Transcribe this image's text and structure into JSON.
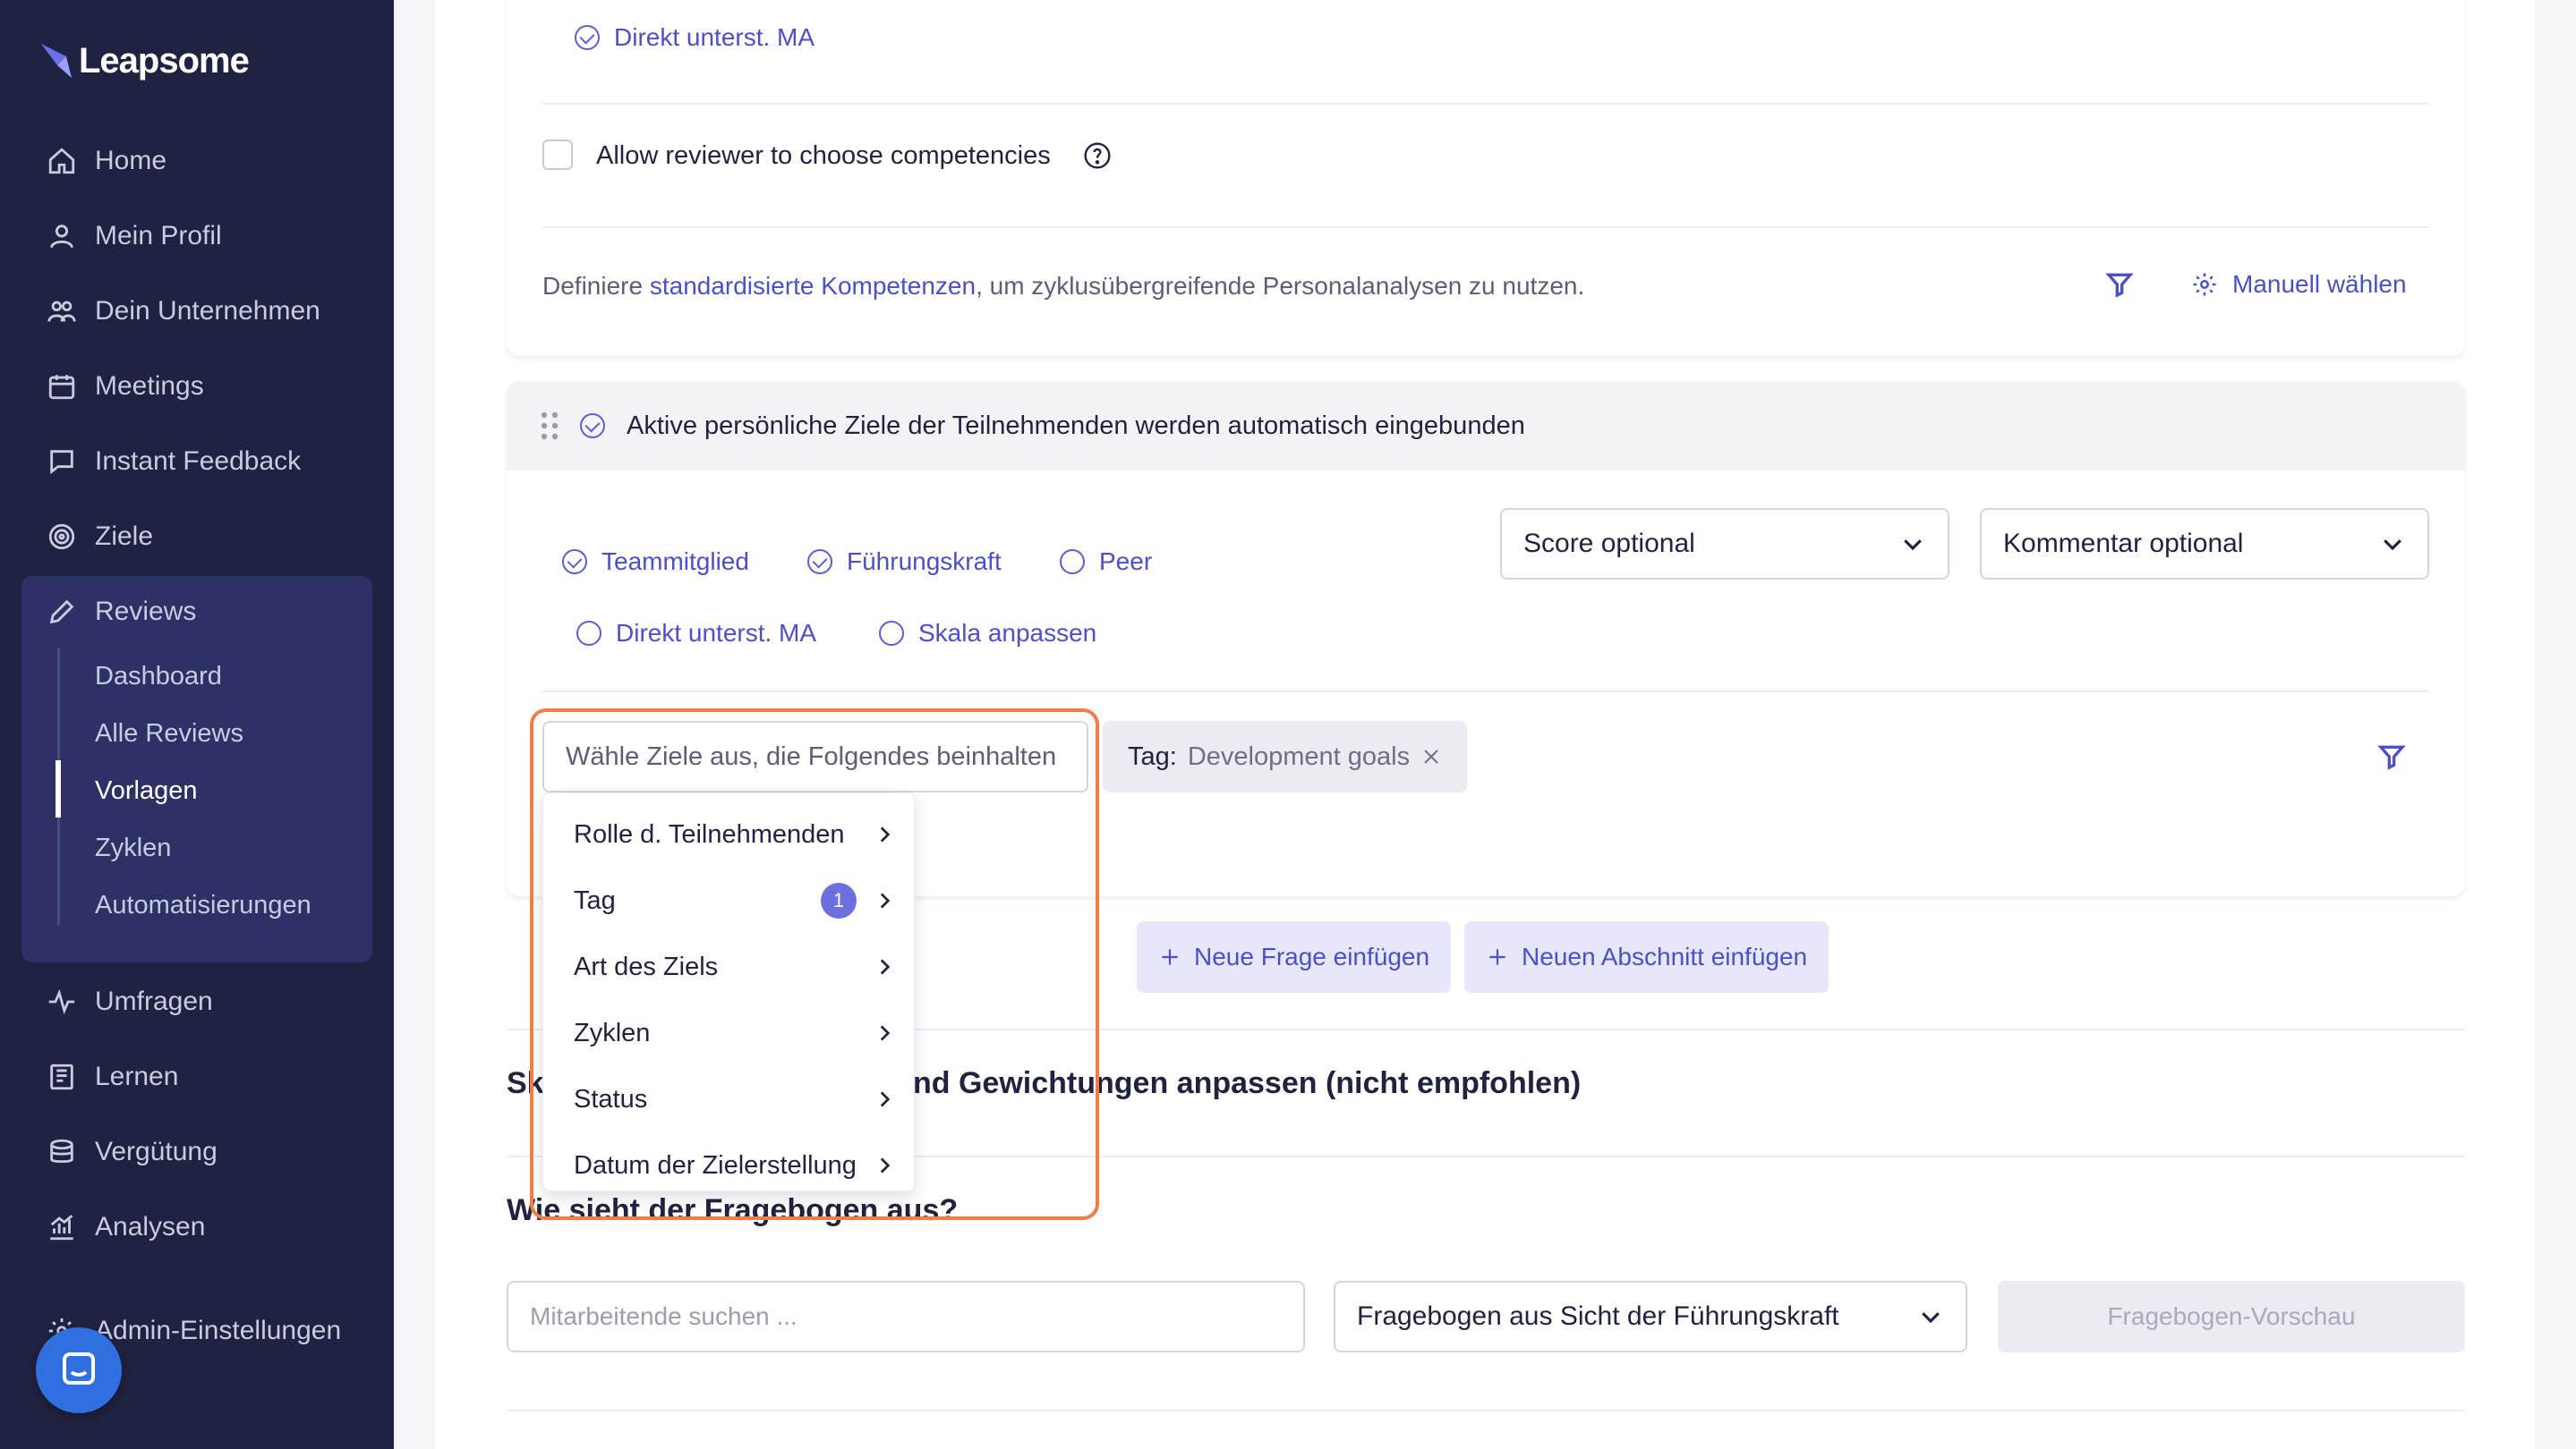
{
  "app": {
    "name": "Leapsome"
  },
  "sidebar": {
    "items": [
      {
        "label": "Home",
        "icon": "home-icon"
      },
      {
        "label": "Mein Profil",
        "icon": "user-icon"
      },
      {
        "label": "Dein Unternehmen",
        "icon": "users-icon"
      },
      {
        "label": "Meetings",
        "icon": "calendar-icon"
      },
      {
        "label": "Instant Feedback",
        "icon": "chat-icon"
      },
      {
        "label": "Ziele",
        "icon": "target-icon"
      },
      {
        "label": "Reviews",
        "icon": "pencil-icon"
      },
      {
        "label": "Umfragen",
        "icon": "pulse-icon"
      },
      {
        "label": "Lernen",
        "icon": "book-icon"
      },
      {
        "label": "Vergütung",
        "icon": "coins-icon"
      },
      {
        "label": "Analysen",
        "icon": "chart-icon"
      },
      {
        "label": "Admin-Einstellungen",
        "icon": "gear-icon"
      }
    ],
    "reviews_sub": [
      {
        "label": "Dashboard"
      },
      {
        "label": "Alle Reviews"
      },
      {
        "label": "Vorlagen",
        "active": true
      },
      {
        "label": "Zyklen"
      },
      {
        "label": "Automatisierungen"
      }
    ]
  },
  "competency_card": {
    "option_direkt": "Direkt unterst. MA",
    "allow_reviewer_label": "Allow reviewer to choose competencies",
    "define_prefix": "Definiere ",
    "define_link": "standardisierte Kompetenzen",
    "define_suffix": ", um zyklusübergreifende Personalanalysen zu nutzen.",
    "manual_select": "Manuell wählen"
  },
  "goals_card": {
    "header": "Aktive persönliche Ziele der Teilnehmenden werden automatisch eingebunden",
    "options": {
      "teammitglied": "Teammitglied",
      "fuehrungskraft": "Führungskraft",
      "peer": "Peer",
      "direkt": "Direkt unterst. MA",
      "skala": "Skala anpassen"
    },
    "score_select": "Score optional",
    "comment_select": "Kommentar optional",
    "filter_placeholder": "Wähle Ziele aus, die Folgendes beinhalten",
    "tag_chip_prefix": "Tag:",
    "tag_chip_value": "Development goals"
  },
  "dropdown": {
    "items": [
      {
        "label": "Rolle d. Teilnehmenden"
      },
      {
        "label": "Tag",
        "badge": "1"
      },
      {
        "label": "Art des Ziels"
      },
      {
        "label": "Zyklen"
      },
      {
        "label": "Status"
      },
      {
        "label": "Datum der Zielerstellung"
      }
    ]
  },
  "actions": {
    "new_question": "Neue Frage einfügen",
    "new_section": "Neuen Abschnitt einfügen"
  },
  "sections": {
    "weights_heading_left": "Sk",
    "weights_heading_right": "nd Gewichtungen anpassen (nicht empfohlen)",
    "preview_heading": "Wie sieht der Fragebogen aus?"
  },
  "preview": {
    "search_placeholder": "Mitarbeitende suchen ...",
    "perspective_select": "Fragebogen aus Sicht der Führungskraft",
    "preview_button": "Fragebogen-Vorschau"
  },
  "colors": {
    "sidebar_bg": "#202241",
    "accent": "#4b50c8",
    "highlight": "#ef7f4a"
  }
}
